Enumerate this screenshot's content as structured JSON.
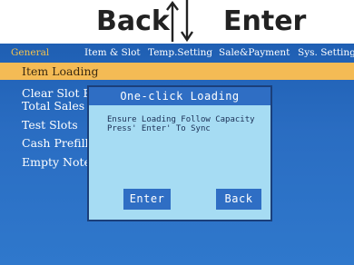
{
  "keys": {
    "back_label": "Back",
    "enter_label": "Enter",
    "back_arrow_icon": "arrow-up-icon",
    "enter_arrow_icon": "arrow-down-icon"
  },
  "tabs": [
    {
      "label": "General",
      "active": true
    },
    {
      "label": "Item & Slot",
      "active": false
    },
    {
      "label": "Temp.Setting",
      "active": false
    },
    {
      "label": "Sale&Payment",
      "active": false
    },
    {
      "label": "Sys. Setting",
      "active": false
    }
  ],
  "menu": [
    {
      "label": "Item Loading",
      "selected": true
    },
    {
      "label": "Clear Slot Err",
      "selected": false
    },
    {
      "label": "Total Sales",
      "selected": false
    },
    {
      "label": "Test Slots",
      "selected": false
    },
    {
      "label": "Cash Prefill",
      "selected": false
    },
    {
      "label": "Empty Note",
      "selected": false
    }
  ],
  "dialog": {
    "title": "One-click Loading",
    "message_line1": "Ensure Loading Follow Capacity",
    "message_line2": "Press' Enter' To Sync",
    "enter_button": "Enter",
    "back_button": "Back"
  },
  "colors": {
    "screen_bg": "#2a6dc2",
    "selected_row": "#f4bb55",
    "active_tab": "#f2c24d",
    "dialog_bg": "#a6dcf3",
    "dialog_accent": "#2f6ec4"
  }
}
